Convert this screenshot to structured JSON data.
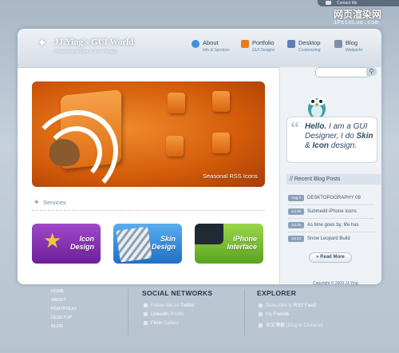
{
  "contact": {
    "label": "Contact Me"
  },
  "watermark": {
    "line1": "网页渲染网",
    "line2": "iPcLoLuo.com"
  },
  "logo": {
    "title": "JJ.Ying's GUI World",
    "subtitle": "Professional Skin & Icon Design"
  },
  "nav": [
    {
      "label": "About",
      "sub": "Info & Services",
      "color": "#3f8fd8"
    },
    {
      "label": "Portfolio",
      "sub": "GUI Designs",
      "color": "#e57c1c"
    },
    {
      "label": "Desktop",
      "sub": "Customizing",
      "color": "#5d7fb6"
    },
    {
      "label": "Blog",
      "sub": "Webpicks",
      "color": "#7f8fa6"
    }
  ],
  "search": {
    "placeholder": ""
  },
  "banner": {
    "caption": "Seasonal RSS Icons"
  },
  "services": {
    "heading": "Services",
    "tiles": [
      {
        "line1": "Icon",
        "line2": "Design",
        "color_top": "#a049c9",
        "color_bottom": "#6d1f9a"
      },
      {
        "line1": "Skin",
        "line2": "Design",
        "color_top": "#59aef0",
        "color_bottom": "#1f6fc4"
      },
      {
        "line1": "iPhone",
        "line2": "Interface",
        "color_top": "#9cd64c",
        "color_bottom": "#5aa41e"
      }
    ]
  },
  "intro": {
    "hello": "Hello.",
    "text1": " I am a GUI Designer, I do ",
    "skin": "Skin",
    "amp": " & ",
    "icon": "Icon",
    "text2": " design."
  },
  "blog": {
    "heading": "// Recent Blog Posts",
    "posts": [
      {
        "date": "Aug 3",
        "title": "DESKTOPOGRAPHY 09"
      },
      {
        "date": "Jul 25",
        "title": "Submedit iPhone Icons"
      },
      {
        "date": "Jul 25",
        "title": "As time goes by, life has"
      },
      {
        "date": "Jul 24",
        "title": "Snow Leopard Build"
      }
    ],
    "read_more": "Read More"
  },
  "copyright": "Copyright © 2009 JJ.Ying",
  "footer": {
    "nav": [
      "HOME",
      "ABOUT",
      "PORTFOLIO",
      "DESKTOP",
      "BLOG"
    ],
    "social": {
      "heading": "SOCIAL NETWORKS",
      "items": [
        {
          "pre": "Follow Me on ",
          "link": "Twitter",
          "post": ""
        },
        {
          "pre": "",
          "link": "LinkedIn",
          "post": " Profile"
        },
        {
          "pre": "",
          "link": "Flickr",
          "post": " Gallery"
        }
      ]
    },
    "explorer": {
      "heading": "EXPLORER",
      "items": [
        {
          "pre": "Subscribe to ",
          "link": "RSS Feed",
          "post": ""
        },
        {
          "pre": "My ",
          "link": "Friends",
          "post": ""
        },
        {
          "pre": "",
          "link": "中文博客",
          "post": " (Blog in Chinese)"
        }
      ]
    }
  }
}
